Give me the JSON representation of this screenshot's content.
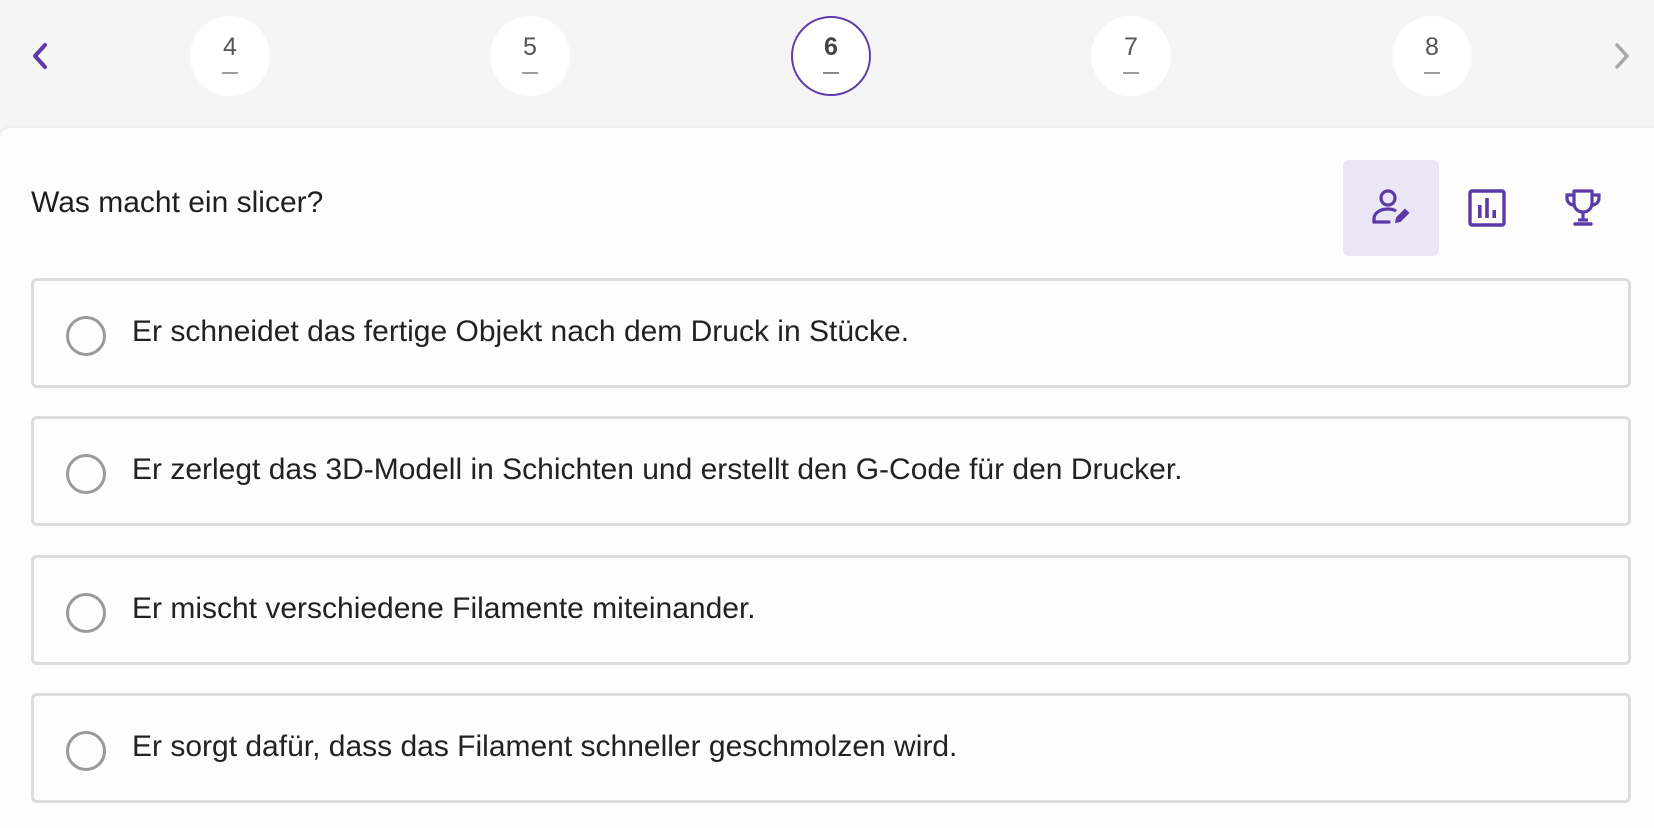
{
  "navigation": {
    "prev_icon": "chevron-left-icon",
    "next_icon": "chevron-right-icon",
    "questions": [
      {
        "number": "4",
        "status": "—"
      },
      {
        "number": "5",
        "status": "—"
      },
      {
        "number": "6",
        "status": "—"
      },
      {
        "number": "7",
        "status": "—"
      },
      {
        "number": "8",
        "status": "—"
      }
    ],
    "active_question": "6"
  },
  "question": {
    "text": "Was macht ein slicer?"
  },
  "toolbar": {
    "icons": [
      "person-edit-icon",
      "bar-chart-icon",
      "trophy-icon"
    ],
    "active": "person-edit-icon"
  },
  "options": [
    {
      "text": "Er schneidet das fertige Objekt nach dem Druck in Stücke."
    },
    {
      "text": "Er zerlegt das 3D-Modell in Schichten und erstellt den G-Code für den Drucker."
    },
    {
      "text": "Er mischt verschiedene Filamente miteinander."
    },
    {
      "text": "Er sorgt dafür, dass das Filament schneller geschmolzen wird."
    }
  ],
  "colors": {
    "accent": "#5b3aa8",
    "active_tool_bg": "#ebe6f5",
    "page_bg": "#f5f5f5",
    "option_border": "#dcdcdc"
  }
}
